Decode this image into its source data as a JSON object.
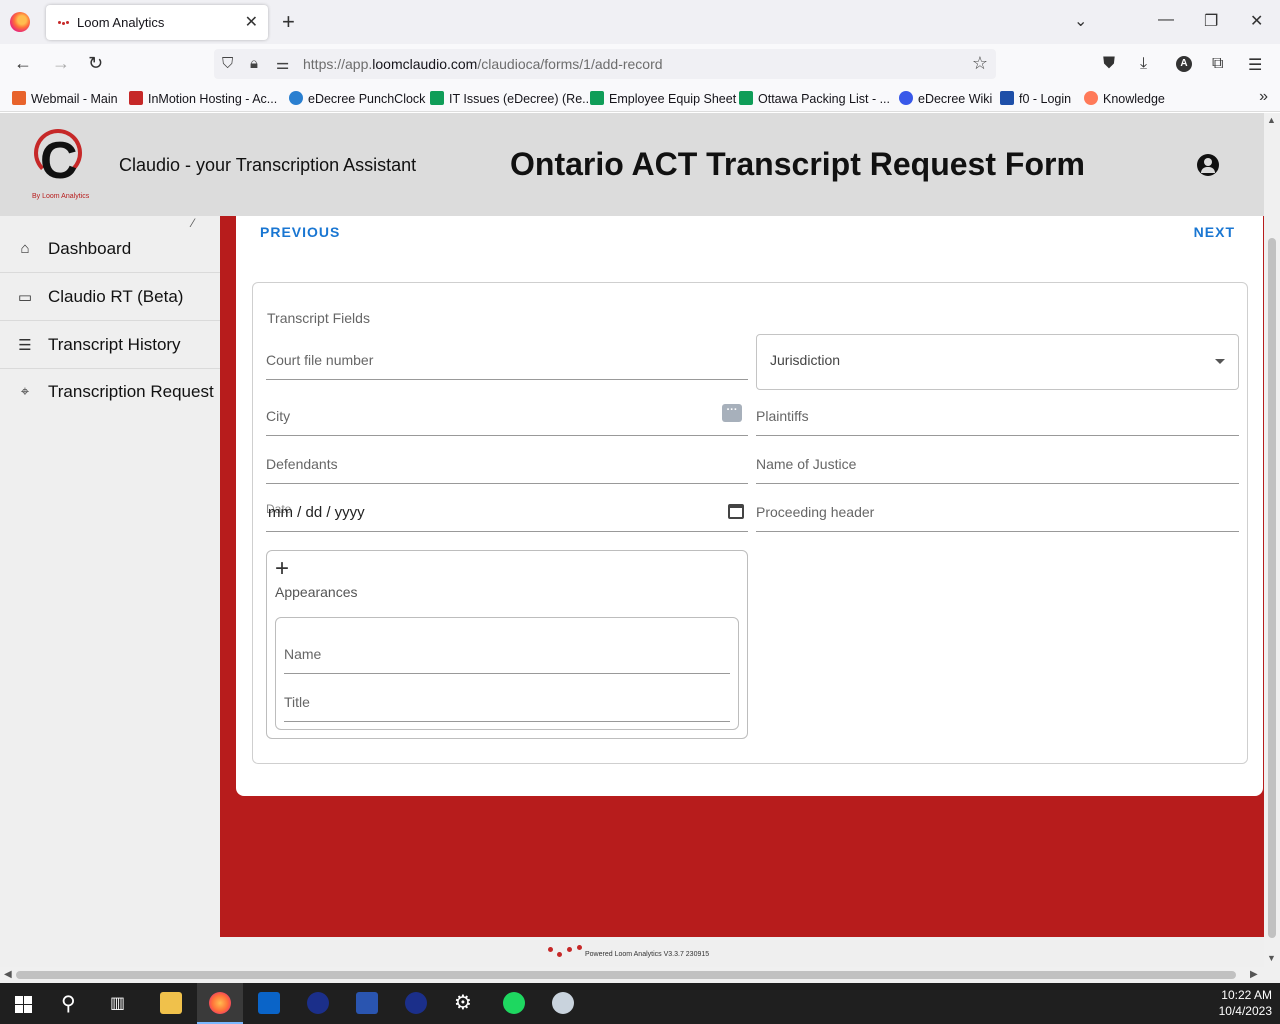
{
  "browser": {
    "tab_title": "Loom Analytics",
    "url_prefix": "https://app.",
    "url_domain": "loomclaudio.com",
    "url_path": "/claudioca/forms/1/add-record",
    "bookmarks": [
      {
        "label": "Webmail - Main",
        "color": "#e8632b"
      },
      {
        "label": "InMotion Hosting - Ac...",
        "color": "#c62828"
      },
      {
        "label": "eDecree PunchClock",
        "color": "#2a7fd0"
      },
      {
        "label": "IT Issues (eDecree) (Re...",
        "color": "#0f9d58"
      },
      {
        "label": "Employee Equip Sheet",
        "color": "#0f9d58"
      },
      {
        "label": "Ottawa Packing List - ...",
        "color": "#0f9d58"
      },
      {
        "label": "eDecree Wiki",
        "color": "#3858e9"
      },
      {
        "label": "f0 - Login",
        "color": "#1e4fa8"
      },
      {
        "label": "Knowledge",
        "color": "#ff7a59"
      }
    ]
  },
  "header": {
    "logo_sub": "By Loom Analytics",
    "app_name": "Claudio - your Transcription Assistant",
    "form_title": "Ontario ACT Transcript Request Form"
  },
  "sidebar": {
    "items": [
      {
        "label": "Dashboard",
        "icon": "store-icon"
      },
      {
        "label": "Claudio RT (Beta)",
        "icon": "monitor-icon"
      },
      {
        "label": "Transcript History",
        "icon": "list-icon"
      },
      {
        "label": "Transcription Request",
        "icon": "tag-icon"
      }
    ]
  },
  "pager": {
    "previous": "PREVIOUS",
    "next": "NEXT"
  },
  "form": {
    "section_label": "Transcript Fields",
    "court_file_number": "Court file number",
    "jurisdiction": "Jurisdiction",
    "city": "City",
    "plaintiffs": "Plaintiffs",
    "defendants": "Defendants",
    "name_of_justice": "Name of Justice",
    "date_label": "Date",
    "date_value": "mm / dd / yyyy",
    "proceeding_header": "Proceeding header",
    "appearances": {
      "label": "Appearances",
      "name": "Name",
      "title": "Title"
    }
  },
  "footer": {
    "text": "Powered Loom Analytics V3.3.7 230915"
  },
  "taskbar": {
    "time": "10:22 AM",
    "date": "10/4/2023"
  }
}
